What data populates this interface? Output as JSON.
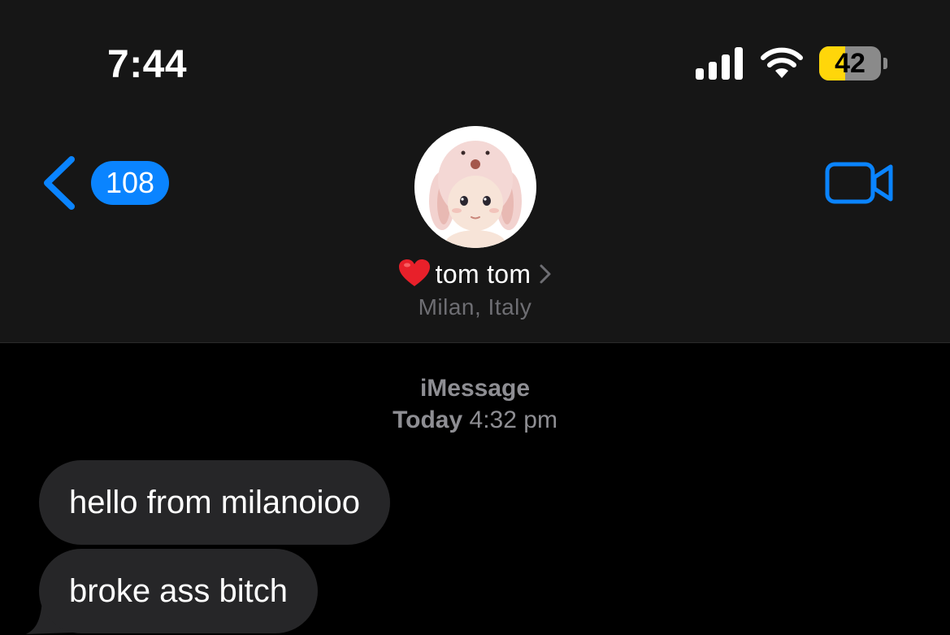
{
  "status_bar": {
    "time": "7:44",
    "battery_level": "42",
    "battery_fraction": 0.42,
    "battery_color": "#ffd60a",
    "icons": [
      "signal-icon",
      "wifi-icon",
      "battery-icon"
    ]
  },
  "nav": {
    "back_count": "108",
    "back_icon": "chevron-left-icon",
    "video_icon": "video-camera-icon",
    "accent_color": "#0a84ff"
  },
  "contact": {
    "name": "tom tom",
    "name_prefix_icon": "red-heart-icon",
    "location": "Milan, Italy",
    "avatar": "doll-avatar"
  },
  "conversation": {
    "service": "iMessage",
    "timestamp_day": "Today",
    "timestamp_time": "4:32 pm",
    "messages": [
      {
        "direction": "incoming",
        "text": "hello from milanoioo"
      },
      {
        "direction": "incoming",
        "text": "broke ass bitch"
      }
    ],
    "incoming_bubble_color": "#262628"
  }
}
